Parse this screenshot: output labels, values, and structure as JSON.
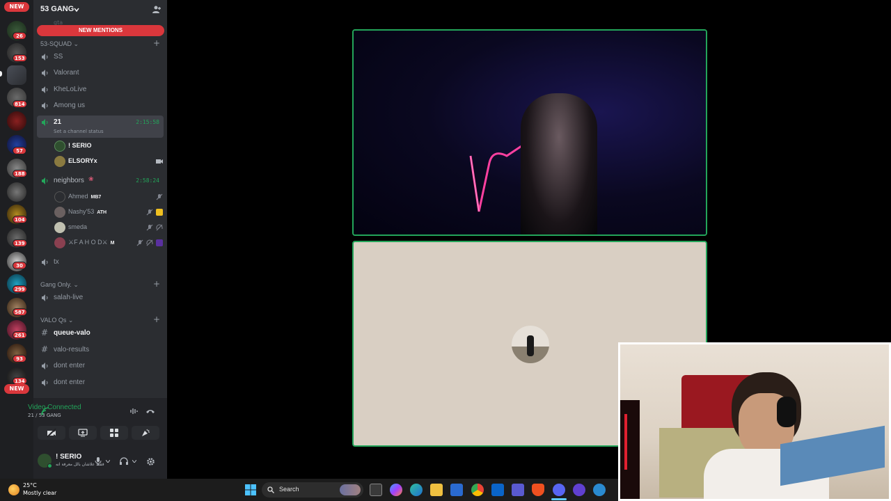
{
  "server": {
    "name": "53 GANG",
    "new_mentions": "NEW MENTIONS",
    "partial_channel": "gta"
  },
  "rail": {
    "new_top": "NEW",
    "new_bottom": "NEW",
    "badges": [
      "26",
      "153",
      "814",
      "57",
      "188",
      "104",
      "139",
      "30",
      "299",
      "587",
      "261",
      "93",
      "134"
    ]
  },
  "categories": {
    "squad": "53-SQUAD",
    "gang_only": "Gang Only.",
    "valo": "VALO Qs"
  },
  "channels": {
    "ss": "SS",
    "valorant": "Valorant",
    "khelolive": "KheLoLive",
    "among_us": "Among us",
    "c21": "21",
    "c21_time": "2:15:58",
    "c21_status": "Set a channel status",
    "neighbors": "neighbors",
    "neighbors_time": "2:58:24",
    "tx": "tx",
    "salah_live": "salah-live",
    "queue_valo": "queue-valo",
    "valo_results": "valo-results",
    "dont_enter_1": "dont enter",
    "dont_enter_2": "dont enter"
  },
  "voice_users_21": [
    {
      "name": "! SERIO"
    },
    {
      "name": "ELSORYx"
    }
  ],
  "voice_users_neighbors": [
    {
      "name": "Ahmed",
      "tag": "MB7"
    },
    {
      "name": "Nashy'53",
      "tag": "ATH"
    },
    {
      "name": "smeda",
      "tag": ""
    },
    {
      "name": "⚔F A H O D⚔",
      "tag": "M"
    }
  ],
  "voice_panel": {
    "title": "Video Connected",
    "subtitle": "21 / 53 GANG"
  },
  "user": {
    "name": "! SERIO",
    "status": "فقط علاشان بالل معرفة انه"
  },
  "taskbar": {
    "temperature": "25°C",
    "condition": "Mostly clear",
    "search_placeholder": "Search"
  },
  "colors": {
    "accent_green": "#23a55a",
    "mention_red": "#da373c",
    "sidebar": "#2b2d31",
    "rail": "#1e1f22"
  }
}
